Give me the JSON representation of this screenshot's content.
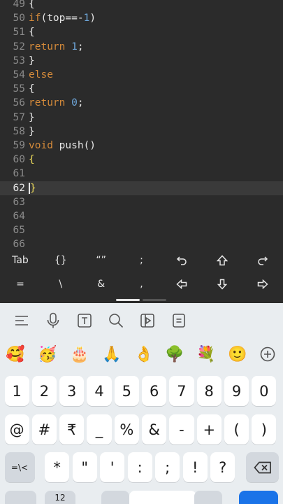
{
  "editor": {
    "lines": [
      {
        "n": "49",
        "code": "{"
      },
      {
        "n": "50",
        "code": "if(top==-1)"
      },
      {
        "n": "51",
        "code": "{"
      },
      {
        "n": "52",
        "code": "return 1;"
      },
      {
        "n": "53",
        "code": "}"
      },
      {
        "n": "54",
        "code": "else"
      },
      {
        "n": "55",
        "code": "{"
      },
      {
        "n": "56",
        "code": "return 0;"
      },
      {
        "n": "57",
        "code": "}"
      },
      {
        "n": "58",
        "code": "}"
      },
      {
        "n": "59",
        "code": "void push()"
      },
      {
        "n": "60",
        "code": "{"
      },
      {
        "n": "61",
        "code": ""
      },
      {
        "n": "62",
        "code": "}"
      },
      {
        "n": "63",
        "code": ""
      },
      {
        "n": "64",
        "code": ""
      },
      {
        "n": "65",
        "code": ""
      },
      {
        "n": "66",
        "code": ""
      }
    ],
    "colors": {
      "background": "#2b2b2b",
      "keyword": "#d48a3a",
      "number": "#6fa8dc",
      "bracket_highlight": "#e8d75b"
    }
  },
  "extra_keys": {
    "row1": [
      "Tab",
      "{}",
      "“”",
      ";",
      "undo-icon",
      "shift-icon",
      "redo-icon"
    ],
    "row1_labels": {
      "tab": "Tab",
      "braces": "{}",
      "quotes": "“”",
      "semicolon": ";"
    },
    "row2_labels": {
      "equals": "=",
      "backslash": "\\",
      "ampersand": "&",
      "comma": ","
    },
    "row2_icons": [
      "arrow-left-icon",
      "arrow-down-icon",
      "arrow-right-icon"
    ]
  },
  "keyboard": {
    "toolbar_icons": [
      "menu-icon",
      "microphone-icon",
      "text-format-icon",
      "search-icon",
      "gif-icon",
      "clipboard-icon"
    ],
    "emojis": [
      "🥰",
      "🥳",
      "🎂",
      "🙏",
      "👌",
      "🌳",
      "💐",
      "🙂"
    ],
    "emoji_add_icon": "plus-circle-icon",
    "row_numbers": [
      "1",
      "2",
      "3",
      "4",
      "5",
      "6",
      "7",
      "8",
      "9",
      "0"
    ],
    "row_symbols": [
      "@",
      "#",
      "₹",
      "_",
      "%",
      "&",
      "-",
      "+",
      "(",
      ")"
    ],
    "row_symbols2": {
      "toggle": "=\\<",
      "keys": [
        "*",
        "\"",
        "'",
        ":",
        ";",
        "!",
        "?"
      ]
    },
    "backspace_icon": "backspace-icon",
    "bottom_partial": {
      "numbers_label": "12"
    },
    "colors": {
      "background": "#e9edf0",
      "key": "#ffffff",
      "accent": "#1a73e8"
    }
  }
}
